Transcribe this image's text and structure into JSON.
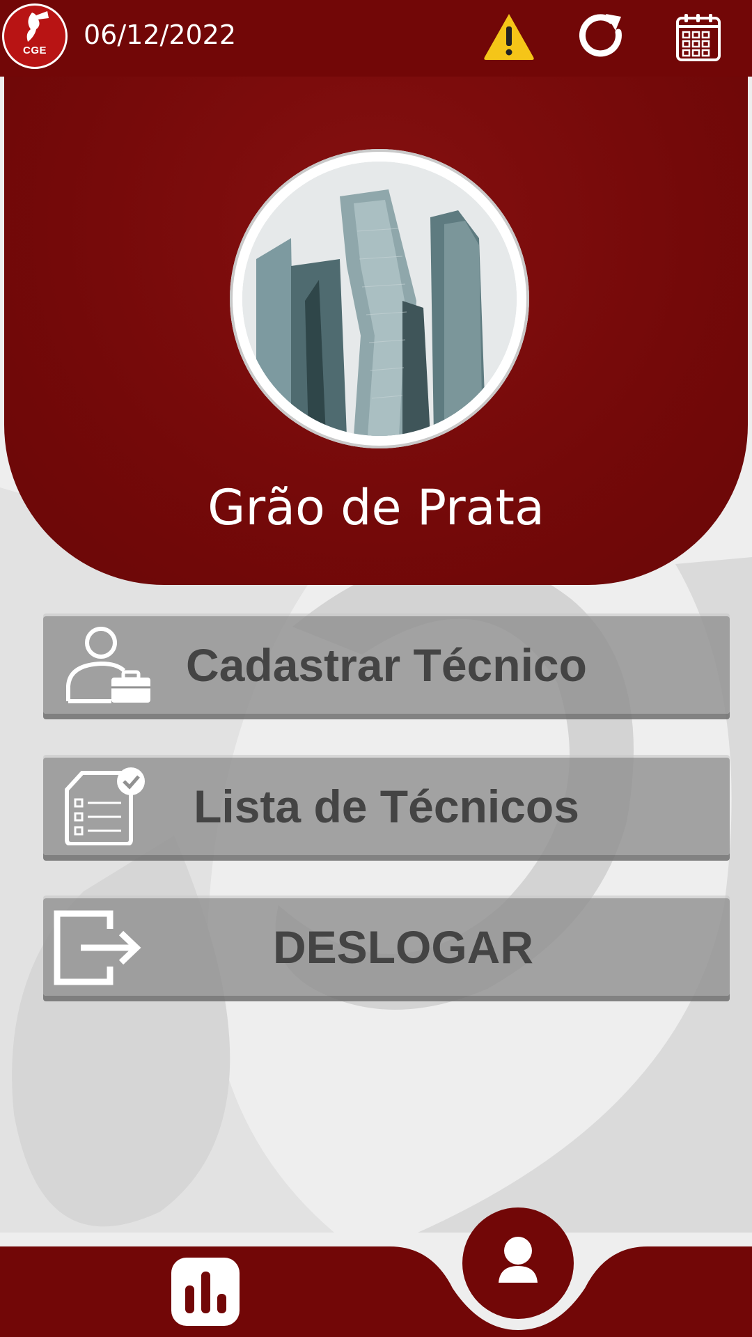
{
  "header": {
    "date": "06/12/2022",
    "logo_text": "CGE",
    "icons": [
      "warning-icon",
      "refresh-icon",
      "calendar-icon"
    ]
  },
  "profile": {
    "name": "Grão de Prata"
  },
  "menu": [
    {
      "label": "Cadastrar Técnico",
      "icon": "user-briefcase-icon"
    },
    {
      "label": "Lista de Técnicos",
      "icon": "checklist-icon"
    },
    {
      "label": "DESLOGAR",
      "icon": "logout-icon"
    }
  ],
  "bottom_nav": {
    "items": [
      "stats-icon",
      "profile-icon"
    ],
    "active": "profile-icon"
  },
  "colors": {
    "brand": "#720707",
    "panel": "#7a0c0c",
    "button": "#919191",
    "button_text": "#444444",
    "warning": "#f5c518"
  }
}
